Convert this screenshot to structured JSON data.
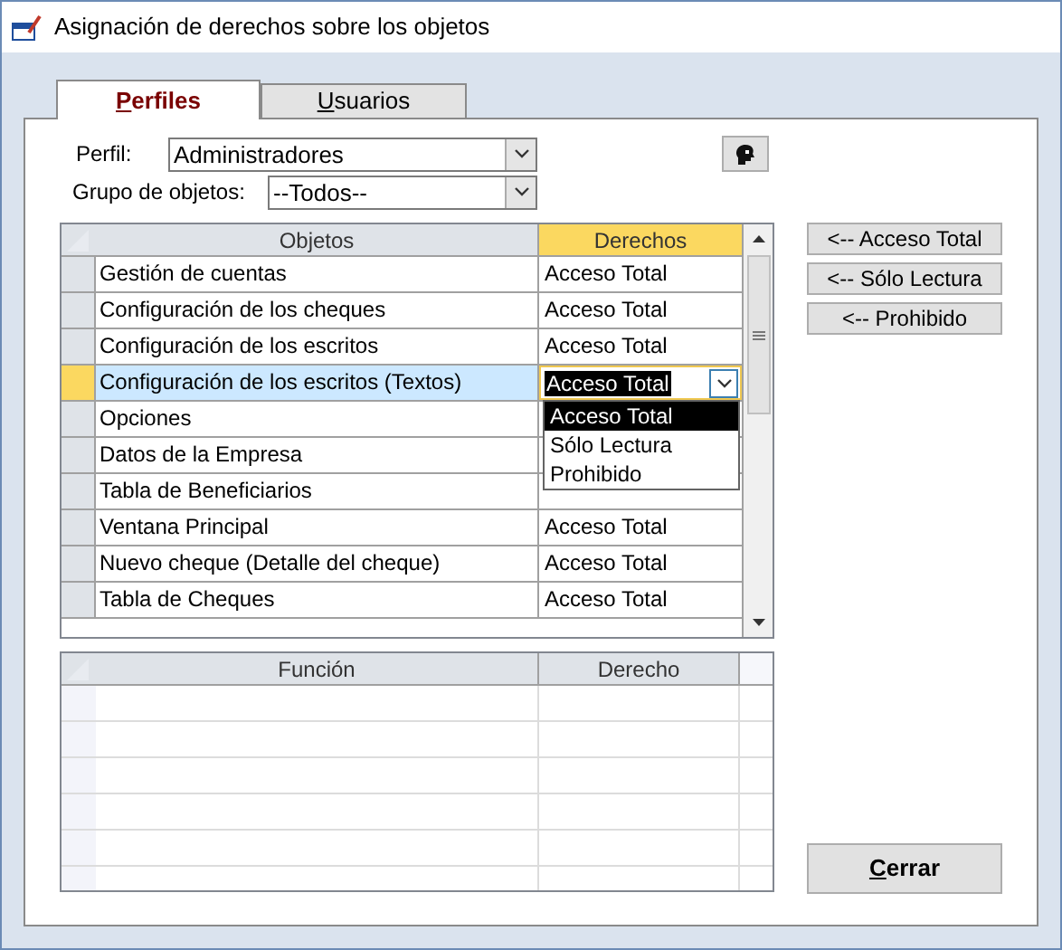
{
  "window": {
    "title": "Asignación de derechos sobre los objetos"
  },
  "tabs": [
    {
      "label": "Perfiles",
      "selected": true
    },
    {
      "label": "Usuarios",
      "selected": false
    }
  ],
  "perfil": {
    "label": "Perfil:",
    "value": "Administradores"
  },
  "grupo": {
    "label": "Grupo de objetos:",
    "value": "--Todos--"
  },
  "objects_table": {
    "columns": [
      "Objetos",
      "Derechos"
    ],
    "rows": [
      {
        "objeto": "Gestión de cuentas",
        "derecho": "Acceso Total",
        "selected": false
      },
      {
        "objeto": "Configuración de los cheques",
        "derecho": "Acceso Total",
        "selected": false
      },
      {
        "objeto": "Configuración de los escritos",
        "derecho": "Acceso Total",
        "selected": false
      },
      {
        "objeto": "Configuración de los escritos (Textos)",
        "derecho": "Acceso Total",
        "selected": true
      },
      {
        "objeto": "Opciones",
        "selected": false
      },
      {
        "objeto": "Datos de la Empresa",
        "selected": false
      },
      {
        "objeto": "Tabla de Beneficiarios",
        "selected": false
      },
      {
        "objeto": "Ventana Principal",
        "derecho": "Acceso Total",
        "selected": false
      },
      {
        "objeto": "Nuevo cheque (Detalle del cheque)",
        "derecho": "Acceso Total",
        "selected": false
      },
      {
        "objeto": "Tabla de Cheques",
        "derecho": "Acceso Total",
        "selected": false
      }
    ],
    "dropdown_options": [
      {
        "label": "Acceso Total",
        "selected": true
      },
      {
        "label": "Sólo Lectura",
        "selected": false
      },
      {
        "label": "Prohibido",
        "selected": false
      }
    ]
  },
  "side_buttons": [
    "<-- Acceso Total",
    "<-- Sólo Lectura",
    "<-- Prohibido"
  ],
  "functions_table": {
    "columns": [
      "Función",
      "Derecho"
    ]
  },
  "close_button": "Cerrar"
}
